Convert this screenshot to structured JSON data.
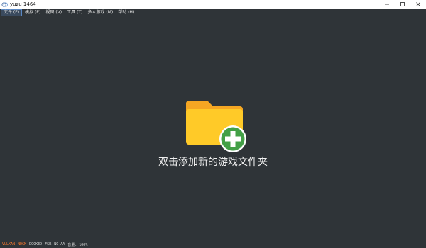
{
  "window": {
    "title": "yuzu 1464",
    "controls": {
      "minimize": "minimize",
      "maximize": "maximize",
      "close": "close"
    }
  },
  "menu": {
    "items": [
      {
        "label": "文件 (F)"
      },
      {
        "label": "模拟 (E)"
      },
      {
        "label": "视图 (V)"
      },
      {
        "label": "工具 (T)"
      },
      {
        "label": "多人游戏 (M)"
      },
      {
        "label": "帮助 (H)"
      }
    ]
  },
  "main": {
    "add_folder_label": "双击添加新的游戏文件夹",
    "icon": "folder-plus-icon"
  },
  "statusbar": {
    "items": [
      {
        "label": "VULKAN",
        "color": "#ff7b2e"
      },
      {
        "label": "NDGM",
        "color": "#ff7b2e"
      },
      {
        "label": "DOCKED"
      },
      {
        "label": "FSR"
      },
      {
        "label": "NO AA"
      },
      {
        "label": "音量: 100%"
      }
    ]
  },
  "colors": {
    "background": "#2f3438",
    "titlebar": "#ffffff",
    "folder_back": "#f5a623",
    "folder_front": "#ffca28",
    "plus_circle": "#43a047",
    "accent": "#ff7b2e"
  }
}
